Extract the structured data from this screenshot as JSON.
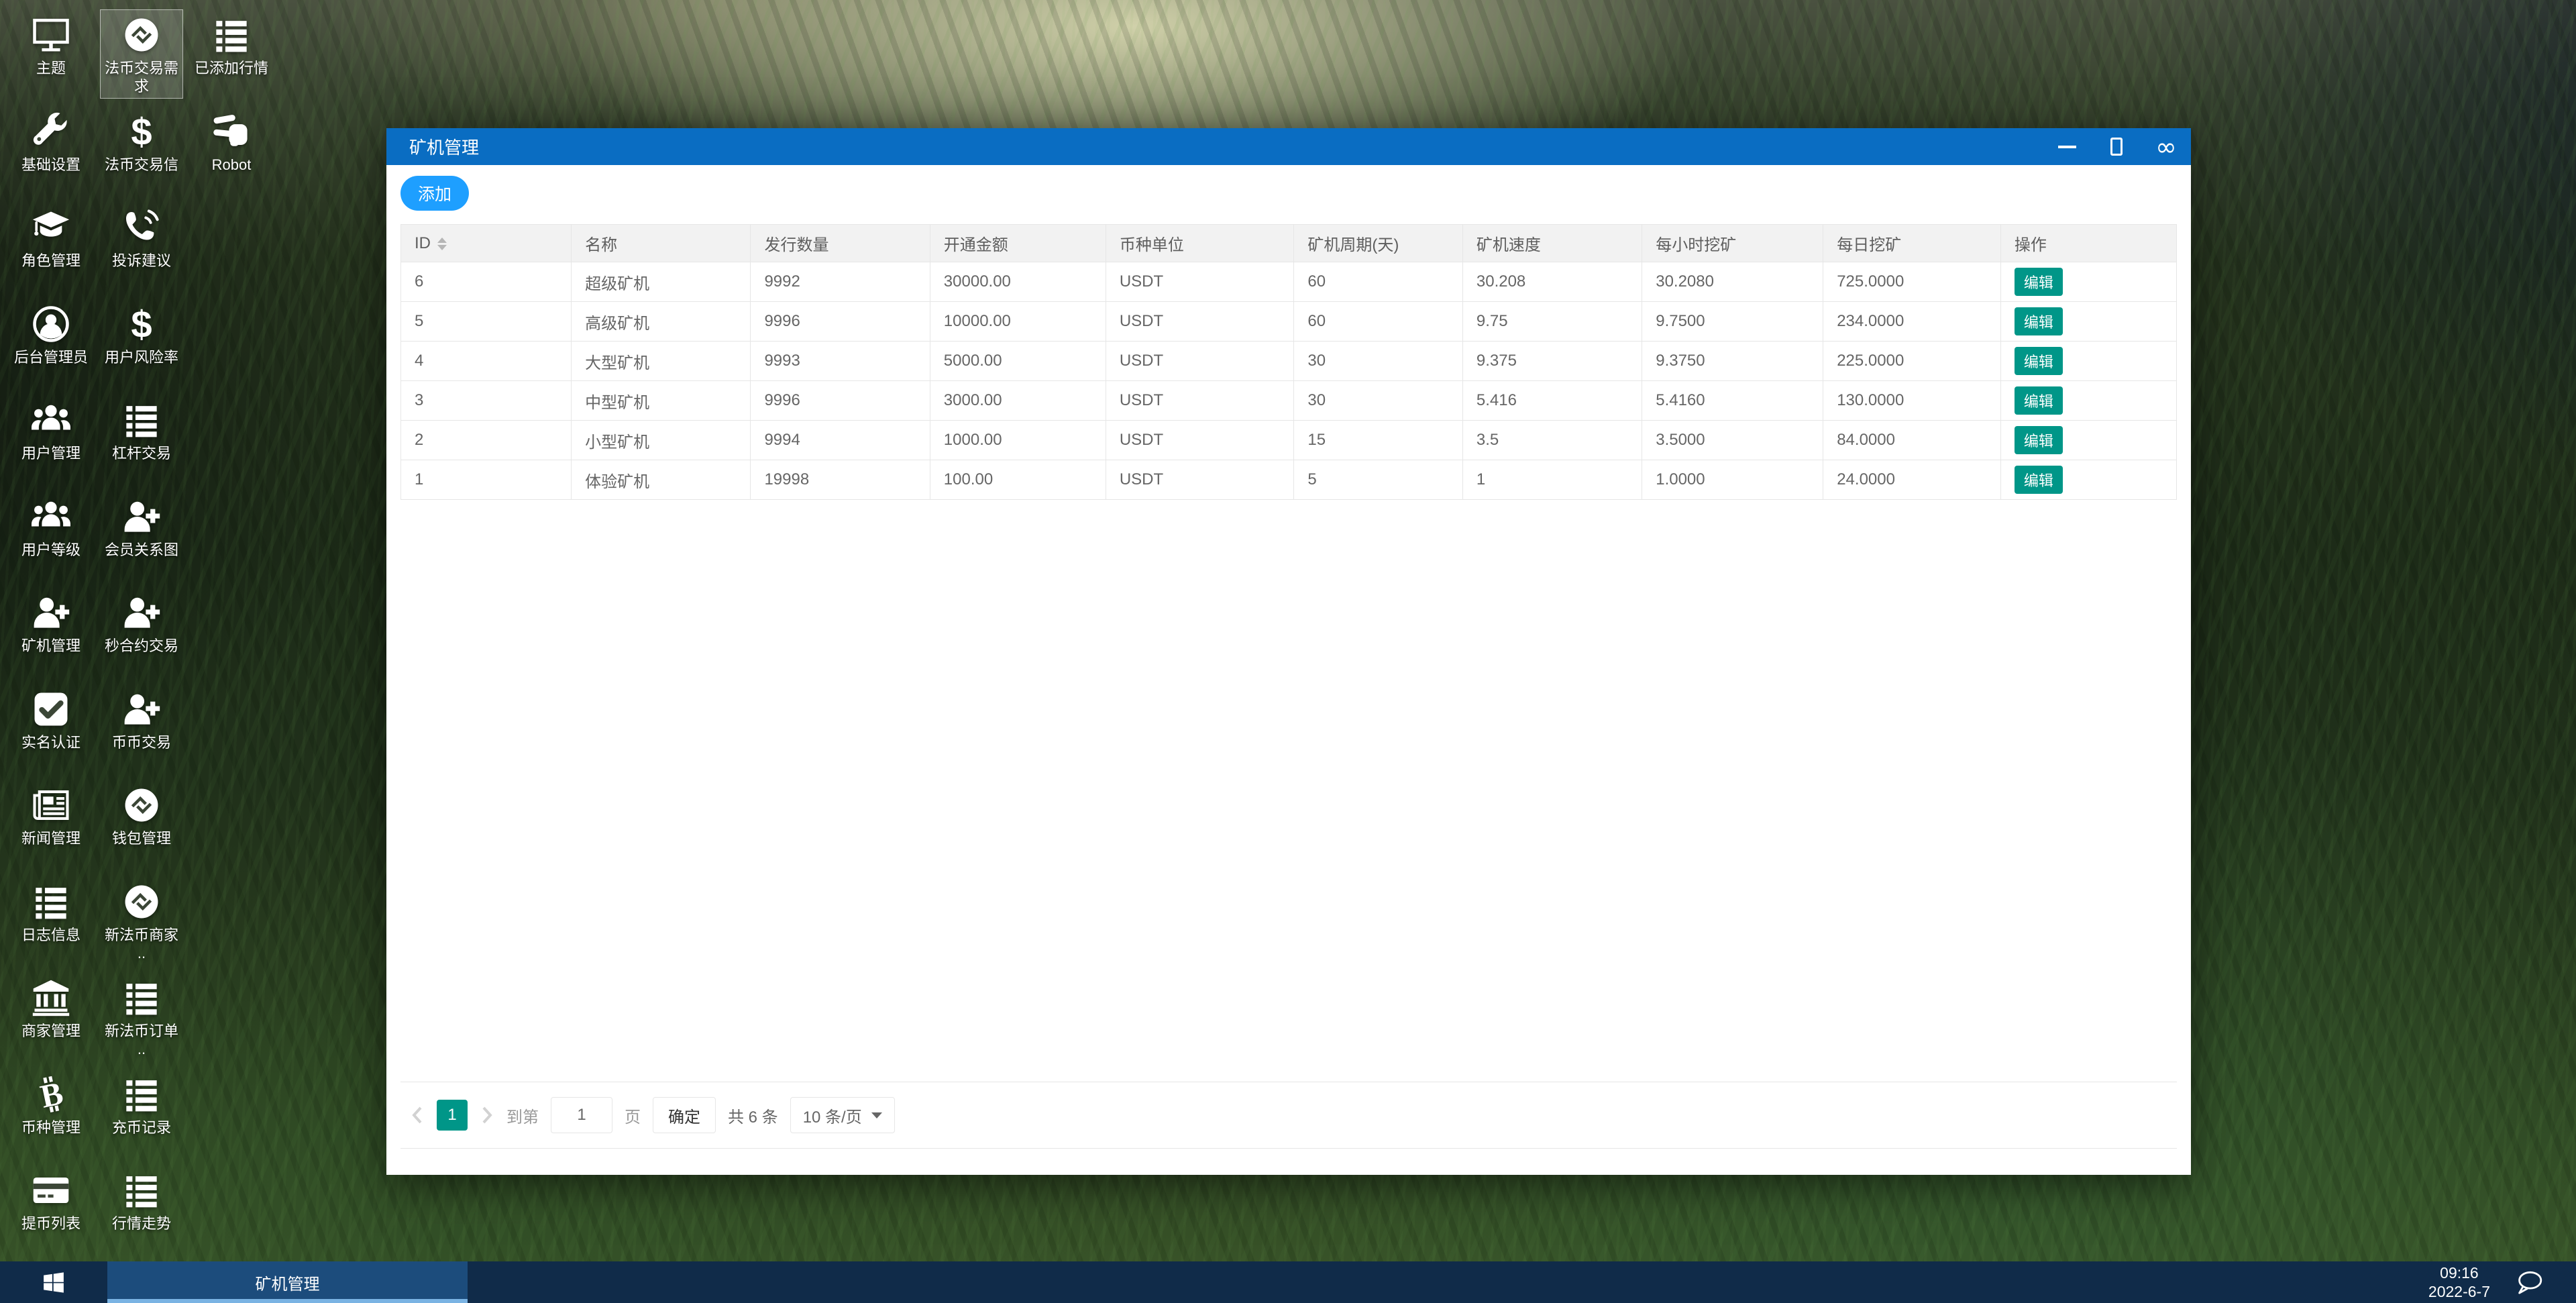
{
  "desktop": {
    "icons": [
      {
        "label": "主题",
        "icon": "monitor",
        "selected": false
      },
      {
        "label": "法币交易需求",
        "icon": "coin-logo",
        "selected": true
      },
      {
        "label": "已添加行情",
        "icon": "list",
        "selected": false
      },
      {
        "label": "基础设置",
        "icon": "wrench",
        "selected": false
      },
      {
        "label": "法币交易信",
        "icon": "dollar",
        "selected": false
      },
      {
        "label": "Robot",
        "icon": "hand-scissors",
        "selected": false
      },
      {
        "label": "角色管理",
        "icon": "graduation-cap",
        "selected": false
      },
      {
        "label": "投诉建议",
        "icon": "phone-volume",
        "selected": false
      },
      {
        "label": "后台管理员",
        "icon": "user-circle",
        "selected": false
      },
      {
        "label": "用户风险率",
        "icon": "dollar",
        "selected": false
      },
      {
        "label": "用户管理",
        "icon": "users",
        "selected": false
      },
      {
        "label": "杠杆交易",
        "icon": "list",
        "selected": false
      },
      {
        "label": "用户等级",
        "icon": "users",
        "selected": false
      },
      {
        "label": "会员关系图",
        "icon": "user-plus",
        "selected": false
      },
      {
        "label": "矿机管理",
        "icon": "user-plus",
        "selected": false
      },
      {
        "label": "秒合约交易",
        "icon": "user-plus",
        "selected": false
      },
      {
        "label": "实名认证",
        "icon": "check-square",
        "selected": false
      },
      {
        "label": "币币交易",
        "icon": "user-plus",
        "selected": false
      },
      {
        "label": "新闻管理",
        "icon": "newspaper",
        "selected": false
      },
      {
        "label": "钱包管理",
        "icon": "coin-logo",
        "selected": false
      },
      {
        "label": "日志信息",
        "icon": "list",
        "selected": false
      },
      {
        "label": "新法币商家\n..",
        "icon": "coin-logo",
        "selected": false
      },
      {
        "label": "商家管理",
        "icon": "bank",
        "selected": false
      },
      {
        "label": "新法币订单\n..",
        "icon": "list",
        "selected": false
      },
      {
        "label": "币种管理",
        "icon": "bitcoin",
        "selected": false
      },
      {
        "label": "充币记录",
        "icon": "list",
        "selected": false
      },
      {
        "label": "提币列表",
        "icon": "credit-card",
        "selected": false
      },
      {
        "label": "行情走势",
        "icon": "list",
        "selected": false
      }
    ]
  },
  "window": {
    "title": "矿机管理",
    "toolbar": {
      "add_label": "添加"
    },
    "table": {
      "columns": [
        "ID",
        "名称",
        "发行数量",
        "开通金额",
        "币种单位",
        "矿机周期(天)",
        "矿机速度",
        "每小时挖矿",
        "每日挖矿",
        "操作"
      ],
      "action_label": "编辑",
      "rows": [
        [
          "6",
          "超级矿机",
          "9992",
          "30000.00",
          "USDT",
          "60",
          "30.208",
          "30.2080",
          "725.0000"
        ],
        [
          "5",
          "高级矿机",
          "9996",
          "10000.00",
          "USDT",
          "60",
          "9.75",
          "9.7500",
          "234.0000"
        ],
        [
          "4",
          "大型矿机",
          "9993",
          "5000.00",
          "USDT",
          "30",
          "9.375",
          "9.3750",
          "225.0000"
        ],
        [
          "3",
          "中型矿机",
          "9996",
          "3000.00",
          "USDT",
          "30",
          "5.416",
          "5.4160",
          "130.0000"
        ],
        [
          "2",
          "小型矿机",
          "9994",
          "1000.00",
          "USDT",
          "15",
          "3.5",
          "3.5000",
          "84.0000"
        ],
        [
          "1",
          "体验矿机",
          "19998",
          "100.00",
          "USDT",
          "5",
          "1",
          "1.0000",
          "24.0000"
        ]
      ]
    },
    "pagination": {
      "current_page": "1",
      "goto_label": "到第",
      "goto_value": "1",
      "page_label": "页",
      "confirm_label": "确定",
      "total_label": "共 6 条",
      "page_size_label": "10 条/页"
    }
  },
  "taskbar": {
    "task_label": "矿机管理",
    "clock_time": "09:16",
    "clock_date": "2022-6-7"
  },
  "colors": {
    "titlebar_blue": "#0a6dc2",
    "accent_blue": "#1E9FFF",
    "teal": "#009688",
    "taskbar_navy": "#102b49",
    "active_task": "#1c4c7c"
  }
}
